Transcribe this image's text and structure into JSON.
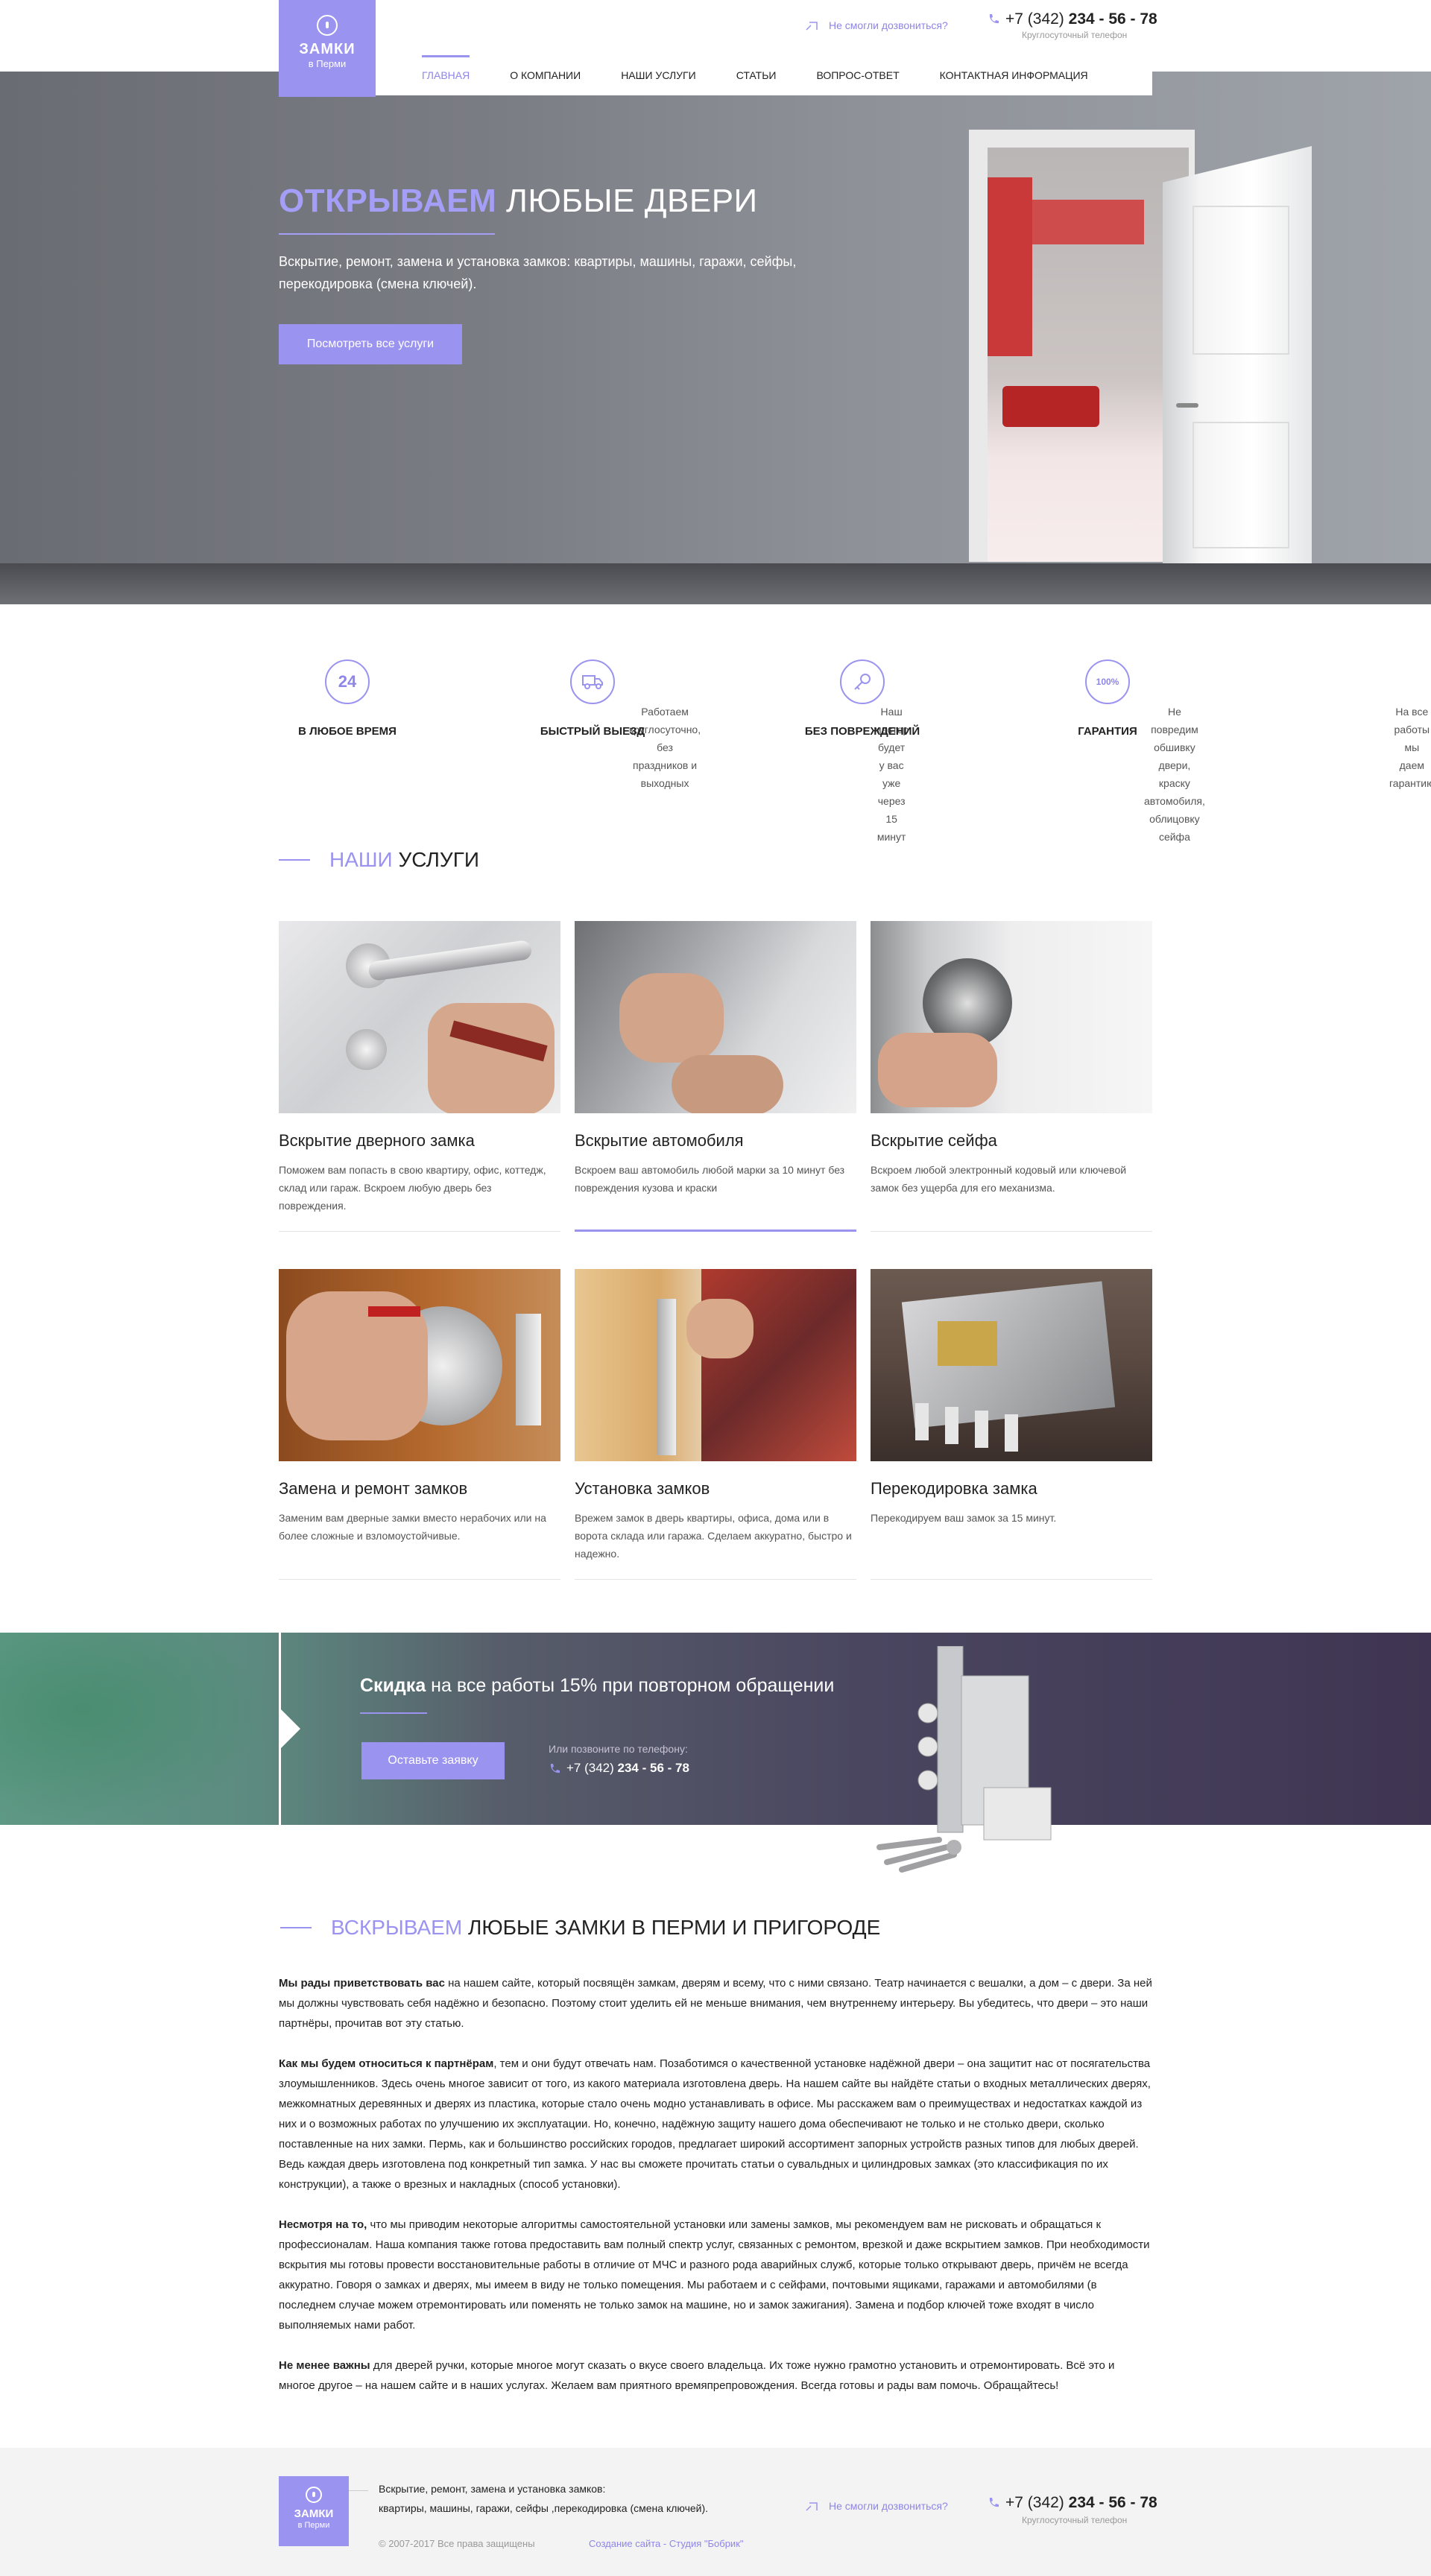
{
  "brand": {
    "name": "ЗАМКИ",
    "city": "в Перми"
  },
  "header": {
    "callback": "Не смогли дозвониться?",
    "phone_prefix": "+7 (342) ",
    "phone_main": "234 - 56 - 78",
    "phone_note": "Круглосуточный телефон"
  },
  "nav": {
    "items": [
      {
        "label": "Главная"
      },
      {
        "label": "О компании"
      },
      {
        "label": "Наши услуги"
      },
      {
        "label": "Статьи"
      },
      {
        "label": "Вопрос-ответ"
      },
      {
        "label": "Контактная информация"
      }
    ]
  },
  "hero": {
    "title_accent": "ОТКРЫВАЕМ",
    "title_rest": "ЛЮБЫЕ ДВЕРИ",
    "text": "Вскрытие, ремонт, замена и установка замков: квартиры, машины, гаражи, сейфы, перекодировка (смена ключей).",
    "button": "Посмотреть все услуги"
  },
  "features": [
    {
      "icon": "24",
      "title": "В любое время",
      "text1": "Работаем круглосуточно,",
      "text2": "без праздников и выходных"
    },
    {
      "icon": "truck",
      "title": "Быстрый выезд",
      "text1": "Наш мастер будет у вас уже",
      "text2": "через 15 минут"
    },
    {
      "icon": "key",
      "title": "Без повреждений",
      "text1": "Не повредим обшивку двери,",
      "text2": "краску автомобиля, облицовку сейфа"
    },
    {
      "icon": "100%",
      "title": "Гарантия",
      "text1": "На все работы мы",
      "text2": "даем гарантию"
    }
  ],
  "services": {
    "title_accent": "НАШИ",
    "title_rest": "УСЛУГИ",
    "items": [
      {
        "title": "Вскрытие дверного замка",
        "text": "Поможем вам попасть в свою квартиру, офис, коттедж, склад или гараж. Вскроем любую дверь без повреждения."
      },
      {
        "title": "Вскрытие автомобиля",
        "text": "Вскроем ваш автомобиль любой марки за 10 минут без повреждения кузова и краски"
      },
      {
        "title": "Вскрытие сейфа",
        "text": "Вскроем любой электронный кодовый или ключевой замок без ущерба для его механизма."
      },
      {
        "title": "Замена и ремонт замков",
        "text": "Заменим вам дверные замки вместо нерабочих или на более сложные и взломоустойчивые."
      },
      {
        "title": "Установка замков",
        "text": "Врежем замок в дверь квартиры, офиса, дома или в ворота склада или гаража. Сделаем аккуратно, быстро и надежно."
      },
      {
        "title": "Перекодировка замка",
        "text": "Перекодируем ваш замок за 15 минут."
      }
    ]
  },
  "promo": {
    "title_bold": "Скидка",
    "title_rest": " на все работы 15% при повторном обращении",
    "button": "Оставьте заявку",
    "sub": "Или позвоните по телефону:",
    "phone_prefix": "+7 (342) ",
    "phone_main": "234 - 56 - 78"
  },
  "article": {
    "title_accent": "ВСКРЫВАЕМ",
    "title_rest": "ЛЮБЫЕ ЗАМКИ В ПЕРМИ И ПРИГОРОДЕ",
    "paragraphs": [
      {
        "bold": "Мы рады приветствовать вас",
        "text": " на нашем сайте, который посвящён замкам, дверям и всему, что с ними связано. Театр начинается с вешалки, а дом – с двери. За ней мы должны чувствовать себя надёжно и безопасно. Поэтому стоит уделить ей не меньше внимания, чем внутреннему интерьеру. Вы убедитесь, что двери – это наши партнёры, прочитав вот эту статью."
      },
      {
        "bold": "Как мы будем относиться к партнёрам",
        "text": ", тем и они будут отвечать нам. Позаботимся о качественной установке надёжной двери – она защитит нас от посягательства злоумышленников. Здесь очень многое зависит от того, из какого материала изготовлена дверь. На нашем сайте вы найдёте статьи о входных металлических дверях, межкомнатных деревянных и дверях из пластика, которые стало очень модно устанавливать в офисе. Мы расскажем вам о преимуществах и недостатках каждой из них и о возможных работах по улучшению их эксплуатации. Но, конечно, надёжную защиту нашего дома обеспечивают не только и не столько двери, сколько поставленные на них замки. Пермь, как и большинство российских городов, предлагает широкий ассортимент запорных устройств разных типов для любых дверей. Ведь каждая дверь изготовлена под конкретный тип замка. У нас вы сможете прочитать статьи о сувальдных и цилиндровых замках (это классификация по их конструкции), а также о врезных и накладных (способ установки)."
      },
      {
        "bold": "Несмотря на то,",
        "text": " что мы приводим некоторые алгоритмы самостоятельной установки или замены замков, мы рекомендуем вам не рисковать и обращаться к профессионалам. Наша компания также готова предоставить вам полный спектр услуг, связанных с ремонтом, врезкой и даже вскрытием замков. При необходимости вскрытия мы готовы провести восстановительные работы в отличие от МЧС и разного рода аварийных служб, которые только открывают дверь, причём не всегда аккуратно. Говоря о замках и дверях, мы имеем в виду не только помещения. Мы работаем и с сейфами, почтовыми ящиками, гаражами и автомобилями (в последнем случае можем отремонтировать или поменять не только замок на машине, но и замок зажигания). Замена и подбор ключей тоже входят в число выполняемых нами работ."
      },
      {
        "bold": "Не менее важны",
        "text": " для дверей ручки, которые многое могут сказать о вкусе своего владельца. Их тоже нужно грамотно установить и отремонтировать. Всё это и многое другое – на нашем сайте и в наших услугах. Желаем вам приятного времяпрепровождения. Всегда готовы и рады вам помочь. Обращайтесь!"
      }
    ]
  },
  "footer": {
    "text1": "Вскрытие, ремонт, замена и установка замков:",
    "text2": "квартиры, машины, гаражи, сейфы ,перекодировка (смена ключей).",
    "copy": "© 2007-2017 Все права защищены",
    "dev": "Создание сайта - Студия \"Бобрик\""
  },
  "colors": {
    "accent": "#9b93f0"
  }
}
